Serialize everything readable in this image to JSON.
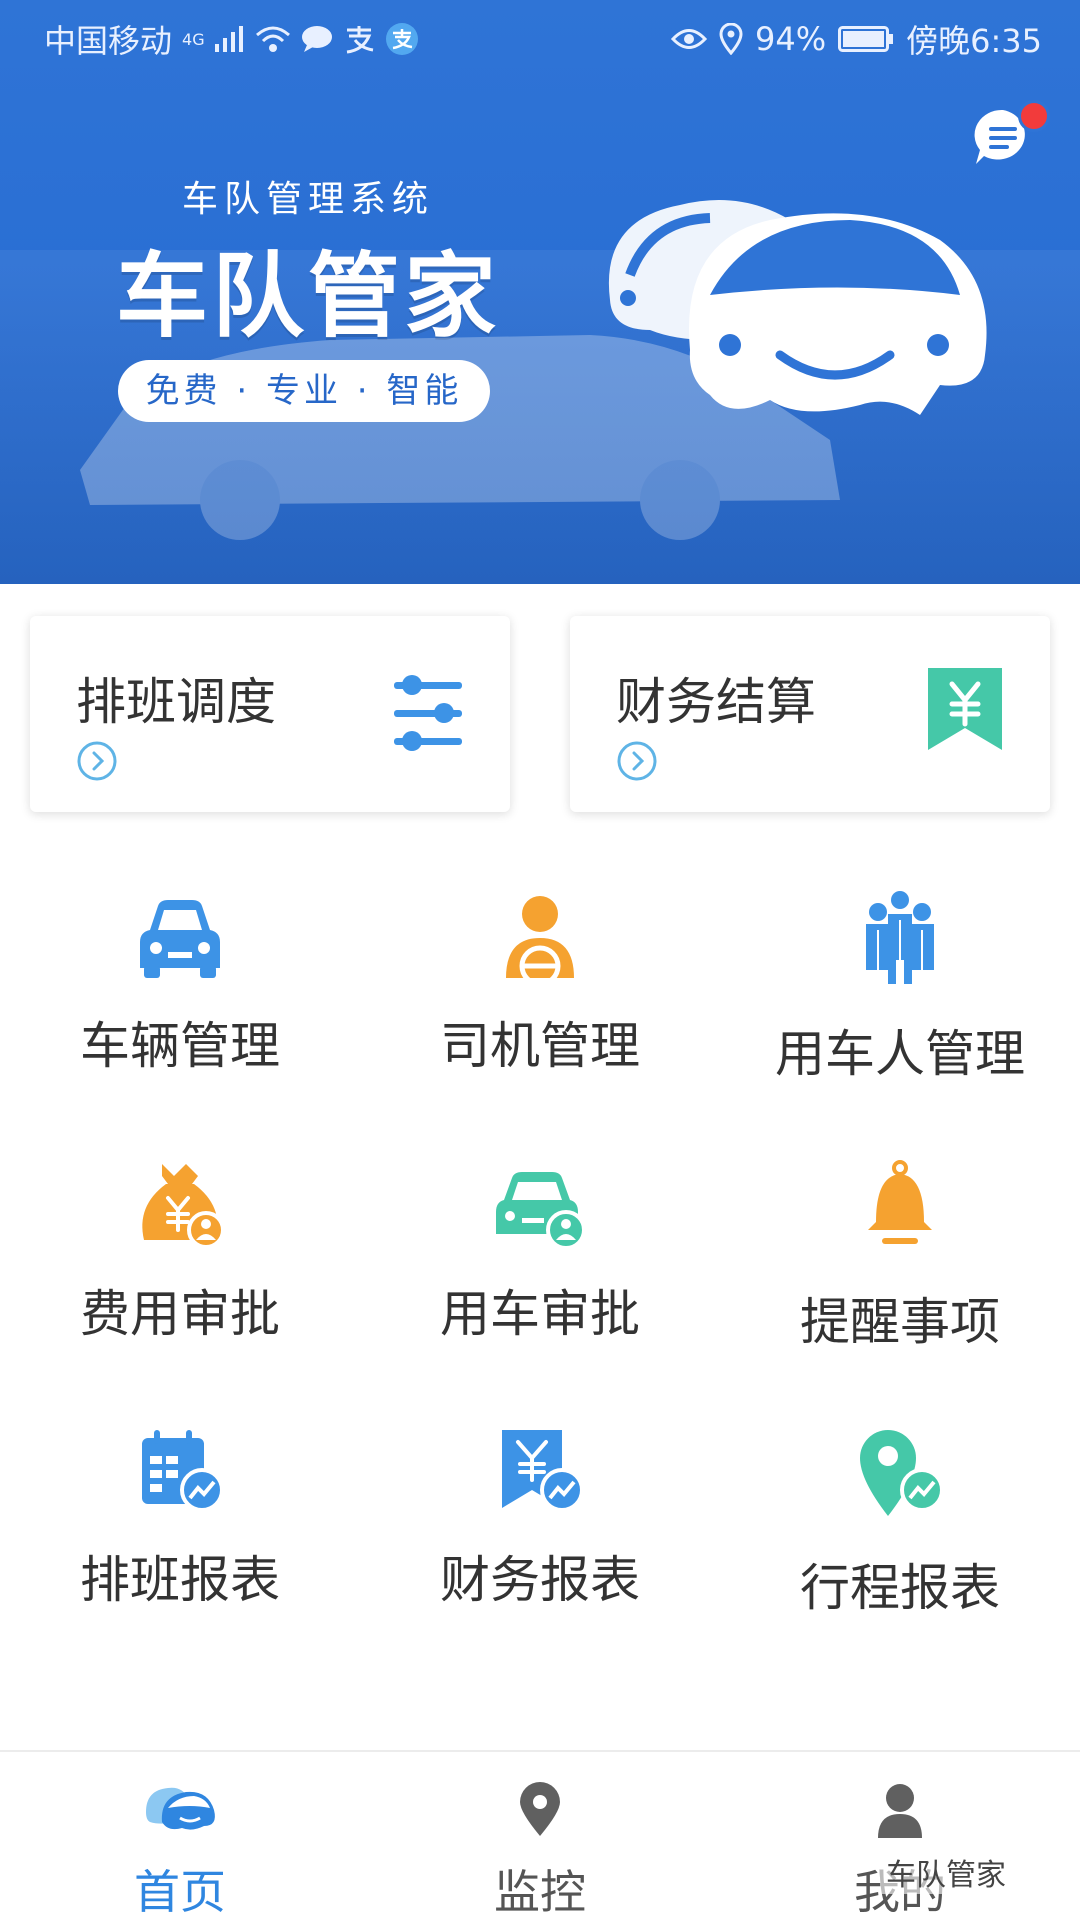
{
  "status_bar": {
    "carrier": "中国移动",
    "network": "4G",
    "battery": "94%",
    "time": "傍晚6:35",
    "icons": [
      "signal-icon",
      "wifi-icon",
      "chat-icon",
      "alipay-icon",
      "eye-icon",
      "location-icon",
      "battery-icon"
    ]
  },
  "hero": {
    "subtitle": "车队管理系统",
    "title": "车队管家",
    "tagline": "免费 · 专业 · 智能",
    "message_icon": "message-icon",
    "has_unread": true
  },
  "cards": [
    {
      "title": "排班调度",
      "icon": "sliders-icon"
    },
    {
      "title": "财务结算",
      "icon": "yuan-bookmark-icon"
    }
  ],
  "grid": [
    {
      "label": "车辆管理",
      "icon": "car-icon"
    },
    {
      "label": "司机管理",
      "icon": "driver-icon"
    },
    {
      "label": "用车人管理",
      "icon": "people-icon"
    },
    {
      "label": "费用审批",
      "icon": "money-bag-icon"
    },
    {
      "label": "用车审批",
      "icon": "car-user-icon"
    },
    {
      "label": "提醒事项",
      "icon": "bell-icon"
    },
    {
      "label": "排班报表",
      "icon": "schedule-chart-icon"
    },
    {
      "label": "财务报表",
      "icon": "finance-chart-icon"
    },
    {
      "label": "行程报表",
      "icon": "trip-chart-icon"
    }
  ],
  "tabs": [
    {
      "label": "首页",
      "icon": "home-car-icon",
      "active": true
    },
    {
      "label": "监控",
      "icon": "map-pin-icon",
      "active": false
    },
    {
      "label": "我的",
      "icon": "user-icon",
      "active": false
    }
  ],
  "watermark": "车队管家",
  "colors": {
    "primary": "#2f74d6",
    "tab_active": "#2f86e0",
    "orange": "#f5a230",
    "teal": "#45c8a8",
    "blue_icon": "#3d93e6",
    "badge_red": "#f23b3b"
  }
}
